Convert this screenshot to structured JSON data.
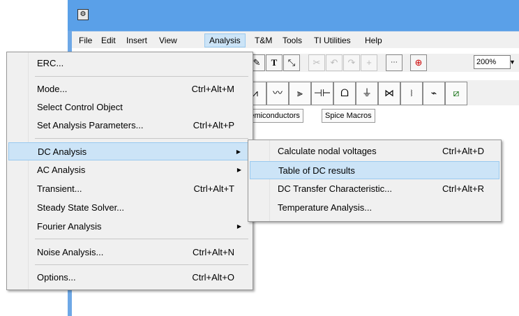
{
  "menubar": {
    "items": [
      "File",
      "Edit",
      "Insert",
      "View",
      "Analysis",
      "T&M",
      "Tools",
      "TI Utilities",
      "Help"
    ],
    "active": "Analysis"
  },
  "toolbar": {
    "zoom": "200%"
  },
  "component_tabs": [
    "Semiconductors",
    "Spice Macros"
  ],
  "analysis_menu": {
    "items": [
      {
        "label": "ERC...",
        "shortcut": ""
      },
      {
        "label": "Mode...",
        "shortcut": "Ctrl+Alt+M"
      },
      {
        "label": "Select Control Object",
        "shortcut": ""
      },
      {
        "label": "Set Analysis Parameters...",
        "shortcut": "Ctrl+Alt+P"
      },
      {
        "label": "DC Analysis",
        "shortcut": "",
        "submenu": true,
        "highlighted": true
      },
      {
        "label": "AC Analysis",
        "shortcut": "",
        "submenu": true
      },
      {
        "label": "Transient...",
        "shortcut": "Ctrl+Alt+T"
      },
      {
        "label": "Steady State Solver...",
        "shortcut": ""
      },
      {
        "label": "Fourier Analysis",
        "shortcut": "",
        "submenu": true
      },
      {
        "label": "Noise Analysis...",
        "shortcut": "Ctrl+Alt+N"
      },
      {
        "label": "Options...",
        "shortcut": "Ctrl+Alt+O"
      }
    ]
  },
  "dc_submenu": {
    "items": [
      {
        "label": "Calculate nodal voltages",
        "shortcut": "Ctrl+Alt+D"
      },
      {
        "label": "Table of DC results",
        "shortcut": "",
        "highlighted": true
      },
      {
        "label": "DC Transfer Characteristic...",
        "shortcut": "Ctrl+Alt+R"
      },
      {
        "label": "Temperature Analysis...",
        "shortcut": ""
      }
    ]
  },
  "colors": {
    "window_frame": "#6ea8e6",
    "menu_highlight": "#cce4f7",
    "menu_highlight_border": "#99c9ef",
    "menu_background": "#f0f0f0"
  }
}
